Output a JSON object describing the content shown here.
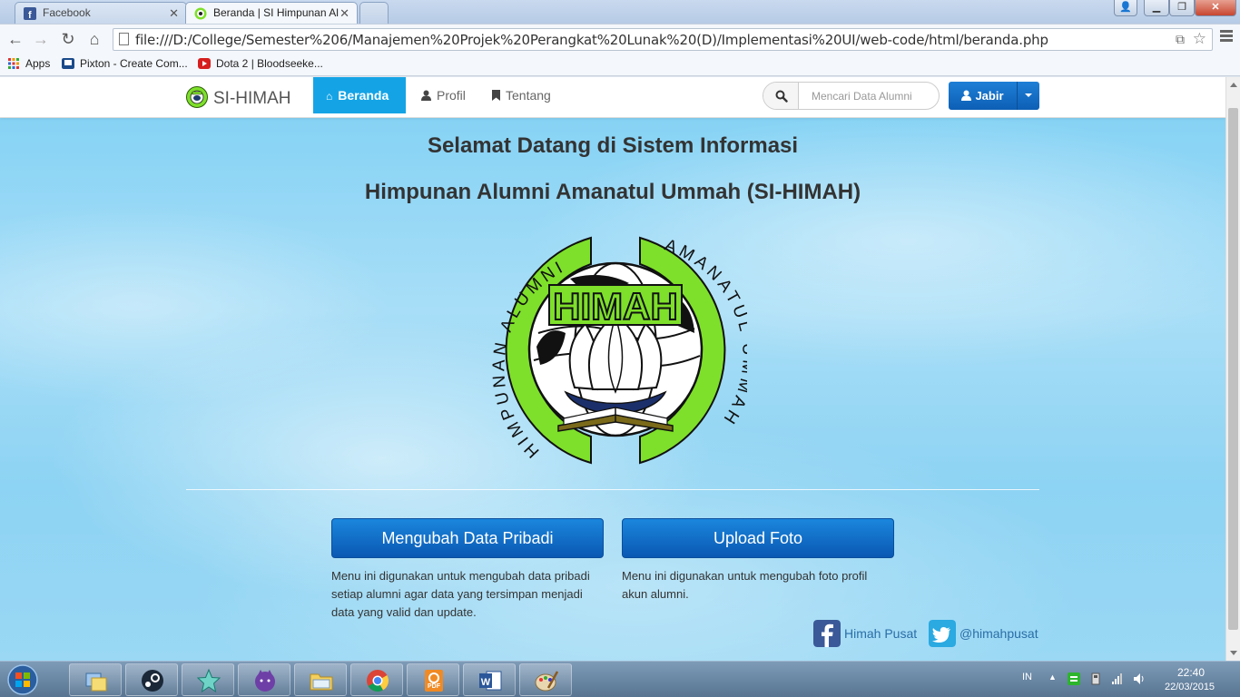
{
  "browser": {
    "tabs": [
      {
        "title": "Facebook",
        "active": false
      },
      {
        "title": "Beranda | SI Himpunan Al",
        "active": true
      }
    ],
    "url": "file:///D:/College/Semester%206/Manajemen%20Projek%20Perangkat%20Lunak%20(D)/Implementasi%20UI/web-code/html/beranda.php",
    "bookmarks": [
      {
        "label": "Apps",
        "icon": "apps-grid-icon"
      },
      {
        "label": "Pixton - Create Com...",
        "icon": "pixton-icon"
      },
      {
        "label": "Dota 2 | Bloodseeke...",
        "icon": "youtube-icon"
      }
    ]
  },
  "site": {
    "brand": "SI-HIMAH",
    "nav": [
      {
        "label": "Beranda",
        "icon": "home-icon",
        "active": true
      },
      {
        "label": "Profil",
        "icon": "user-icon",
        "active": false
      },
      {
        "label": "Tentang",
        "icon": "bookmark-icon",
        "active": false
      }
    ],
    "search": {
      "placeholder": "Mencari Data Alumni",
      "value": ""
    },
    "user": {
      "name": "Jabir"
    }
  },
  "main": {
    "headline1": "Selamat Datang di Sistem Informasi",
    "headline2": "Himpunan Alumni Amanatul Ummah (SI-HIMAH)",
    "logo": {
      "center_text": "HIMAH",
      "left_arc": "HIMPUNAN ALUMNI",
      "right_arc": "AMANATUL UMMAH"
    },
    "actions": [
      {
        "label": "Mengubah Data Pribadi",
        "desc": "Menu ini digunakan untuk mengubah data pribadi setiap alumni agar data yang tersimpan menjadi data yang valid dan update."
      },
      {
        "label": "Upload Foto",
        "desc": "Menu ini digunakan untuk mengubah foto profil akun alumni."
      }
    ],
    "social": [
      {
        "label": "Himah Pusat",
        "icon": "facebook-icon"
      },
      {
        "label": "@himahpusat",
        "icon": "twitter-icon"
      }
    ]
  },
  "taskbar": {
    "apps": [
      "explorer-icon",
      "steam-icon",
      "star-app-icon",
      "cat-app-icon",
      "folder-icon",
      "chrome-icon",
      "pdf-icon",
      "word-icon",
      "paint-icon"
    ],
    "language": "IN",
    "time": "22:40",
    "date": "22/03/2015"
  },
  "colors": {
    "nav_active": "#14a4e6",
    "button_primary": "#0d5fb5",
    "logo_green": "#7ee02a",
    "page_sky": "#8dd3f3"
  }
}
